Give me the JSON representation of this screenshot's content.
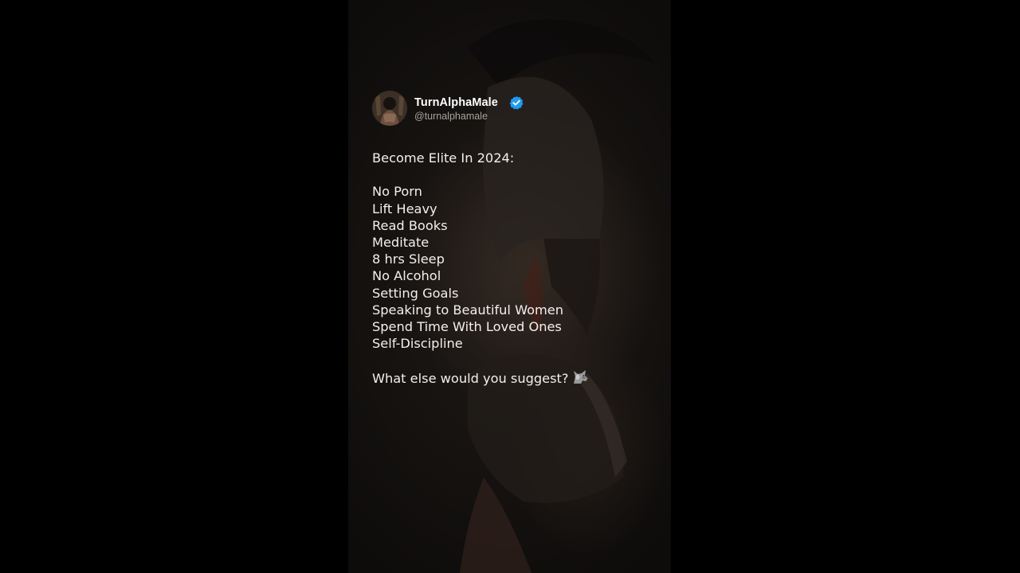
{
  "author": {
    "display_name": "TurnAlphaMale",
    "handle": "@turnalphamale",
    "verified": true,
    "verified_color": "#1d9bf0"
  },
  "post": {
    "title": "Become Elite In 2024:",
    "items": [
      "No Porn",
      "Lift Heavy",
      "Read Books",
      "Meditate",
      "8 hrs Sleep",
      "No Alcohol",
      "Setting Goals",
      "Speaking to Beautiful Women",
      "Spend Time With Loved Ones",
      "Self-Discipline"
    ],
    "closing": "What else would you suggest?",
    "closing_emoji": "wolf-emoji"
  },
  "background": {
    "subject": "spartan-warrior-helmet",
    "tone": "#151210"
  }
}
